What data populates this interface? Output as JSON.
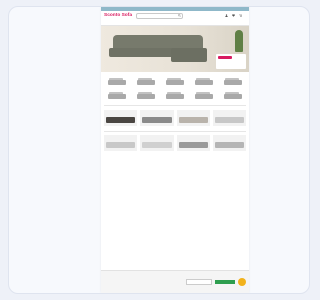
{
  "promo_bar": {
    "items": [
      "",
      "",
      ""
    ]
  },
  "header": {
    "logo_text": "Sconto Sofa",
    "search_placeholder": "",
    "cart_count": ""
  },
  "nav": {
    "items": [
      "",
      "",
      "",
      "",
      "",
      "",
      "",
      ""
    ]
  },
  "hero": {
    "card_title": "",
    "card_price": "",
    "card_button": ""
  },
  "categories": {
    "title": "",
    "items": [
      {
        "label": ""
      },
      {
        "label": ""
      },
      {
        "label": ""
      },
      {
        "label": ""
      },
      {
        "label": ""
      },
      {
        "label": ""
      },
      {
        "label": ""
      },
      {
        "label": ""
      },
      {
        "label": ""
      },
      {
        "label": ""
      }
    ]
  },
  "bestsellers": {
    "title": "",
    "products": [
      {
        "name": "",
        "price": "",
        "badge": "",
        "color": "#4a4642"
      },
      {
        "name": "",
        "price": "",
        "badge": "",
        "color": "#8a8a8a"
      },
      {
        "name": "",
        "price": "",
        "badge": "",
        "color": "#b9b3ab"
      },
      {
        "name": "",
        "price": "",
        "badge": "",
        "color": "#c7c7c7"
      }
    ]
  },
  "new_arrivals": {
    "title": "",
    "products": [
      {
        "name": "",
        "price": "",
        "badge": "",
        "color": "#c8c8c8"
      },
      {
        "name": "",
        "price": "",
        "badge": "",
        "color": "#d0d0d0"
      },
      {
        "name": "",
        "price": "",
        "badge": "",
        "color": "#9a9a9a"
      },
      {
        "name": "",
        "price": "",
        "badge": "",
        "color": "#b5b5b5"
      }
    ]
  },
  "newsletter": {
    "text": "",
    "input_placeholder": "",
    "button_label": ""
  },
  "colors": {
    "brand": "#d81b60",
    "promo": "#8fb8c9",
    "badge": "#27ae60",
    "cta": "#2e9e4f"
  }
}
